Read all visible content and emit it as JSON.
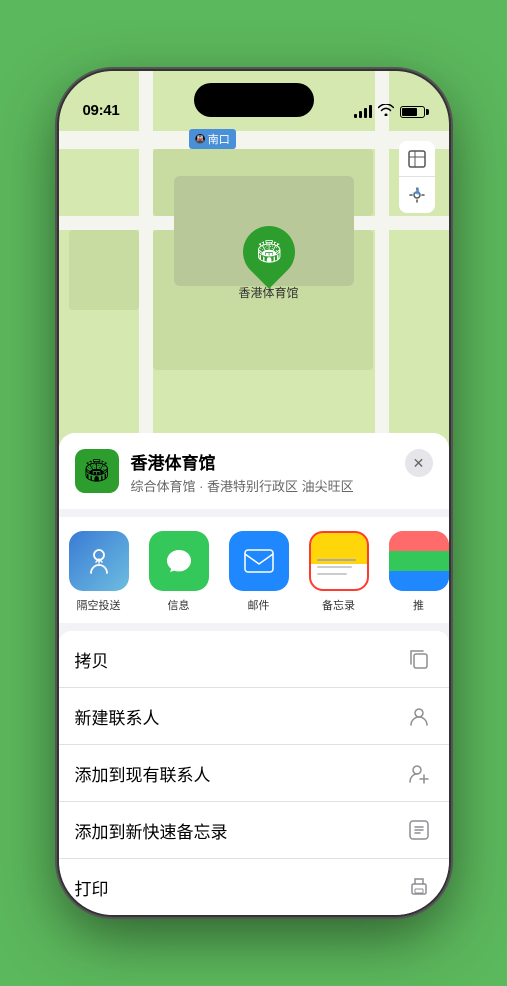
{
  "status_bar": {
    "time": "09:41",
    "arrow_icon": "▶"
  },
  "map": {
    "label_text": "南口",
    "map_icon": "🗺",
    "location_icon": "🏟",
    "pin_label": "香港体育馆",
    "control_map": "🗺",
    "control_location": "⬆"
  },
  "place_header": {
    "icon": "🏟",
    "name": "香港体育馆",
    "description": "综合体育馆 · 香港特别行政区 油尖旺区",
    "close_label": "✕"
  },
  "share_actions": [
    {
      "id": "airdrop",
      "label": "隔空投送",
      "type": "airdrop"
    },
    {
      "id": "message",
      "label": "信息",
      "type": "message"
    },
    {
      "id": "mail",
      "label": "邮件",
      "type": "mail"
    },
    {
      "id": "notes",
      "label": "备忘录",
      "type": "notes"
    },
    {
      "id": "more",
      "label": "推",
      "type": "more"
    }
  ],
  "action_items": [
    {
      "id": "copy",
      "label": "拷贝",
      "icon": "⎘"
    },
    {
      "id": "new-contact",
      "label": "新建联系人",
      "icon": "👤"
    },
    {
      "id": "add-existing",
      "label": "添加到现有联系人",
      "icon": "👤"
    },
    {
      "id": "add-notes",
      "label": "添加到新快速备忘录",
      "icon": "⊞"
    },
    {
      "id": "print",
      "label": "打印",
      "icon": "🖨"
    }
  ]
}
